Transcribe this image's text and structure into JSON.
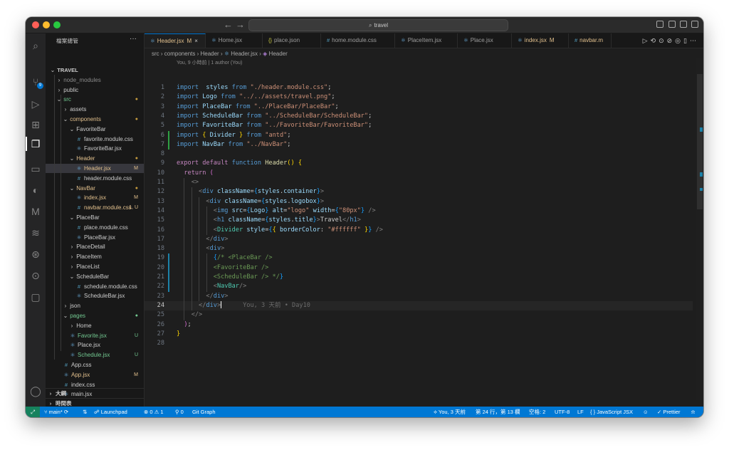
{
  "titlebar": {
    "search": "travel",
    "back": "←",
    "forward": "→"
  },
  "sidebar": {
    "title": "檔案總管",
    "more": "···",
    "tree": [
      {
        "label": "TRAVEL",
        "depth": 0,
        "type": "root",
        "chevron": "v",
        "bold": true
      },
      {
        "label": "node_modules",
        "depth": 1,
        "type": "folder",
        "chevron": ">",
        "color": "#8b8b8b"
      },
      {
        "label": "public",
        "depth": 1,
        "type": "folder",
        "chevron": ">"
      },
      {
        "label": "src",
        "depth": 1,
        "type": "folder",
        "chevron": "v",
        "color": "#73c991",
        "badge": "●",
        "badge_color": "#c49a3e"
      },
      {
        "label": "assets",
        "depth": 2,
        "type": "folder",
        "chevron": ">"
      },
      {
        "label": "components",
        "depth": 2,
        "type": "folder",
        "chevron": "v",
        "color": "#e2c08d",
        "badge": "●",
        "badge_color": "#c49a3e"
      },
      {
        "label": "FavoriteBar",
        "depth": 3,
        "type": "folder",
        "chevron": "v"
      },
      {
        "label": "favorite.module.css",
        "depth": 4,
        "type": "css"
      },
      {
        "label": "FavoriteBar.jsx",
        "depth": 4,
        "type": "react"
      },
      {
        "label": "Header",
        "depth": 3,
        "type": "folder",
        "chevron": "v",
        "color": "#e2c08d",
        "badge": "●",
        "badge_color": "#c49a3e"
      },
      {
        "label": "Header.jsx",
        "depth": 4,
        "type": "react",
        "color": "#e2c08d",
        "badge": "M",
        "badge_color": "#e2c08d",
        "selected": true
      },
      {
        "label": "header.module.css",
        "depth": 4,
        "type": "css"
      },
      {
        "label": "NavBar",
        "depth": 3,
        "type": "folder",
        "chevron": "v",
        "color": "#e2c08d",
        "badge": "●",
        "badge_color": "#c49a3e"
      },
      {
        "label": "index.jsx",
        "depth": 4,
        "type": "react",
        "color": "#e2c08d",
        "badge": "M",
        "badge_color": "#e2c08d"
      },
      {
        "label": "navbar.module.css",
        "depth": 4,
        "type": "css",
        "color": "#e2c08d",
        "badge": "1, U",
        "badge_color": "#e2c08d"
      },
      {
        "label": "PlaceBar",
        "depth": 3,
        "type": "folder",
        "chevron": "v"
      },
      {
        "label": "place.module.css",
        "depth": 4,
        "type": "css"
      },
      {
        "label": "PlaceBar.jsx",
        "depth": 4,
        "type": "react"
      },
      {
        "label": "PlaceDetail",
        "depth": 3,
        "type": "folder",
        "chevron": ">"
      },
      {
        "label": "PlaceItem",
        "depth": 3,
        "type": "folder",
        "chevron": ">"
      },
      {
        "label": "PlaceList",
        "depth": 3,
        "type": "folder",
        "chevron": ">"
      },
      {
        "label": "ScheduleBar",
        "depth": 3,
        "type": "folder",
        "chevron": "v"
      },
      {
        "label": "schedule.module.css",
        "depth": 4,
        "type": "css"
      },
      {
        "label": "ScheduleBar.jsx",
        "depth": 4,
        "type": "react"
      },
      {
        "label": "json",
        "depth": 2,
        "type": "folder",
        "chevron": ">"
      },
      {
        "label": "pages",
        "depth": 2,
        "type": "folder",
        "chevron": "v",
        "color": "#73c991",
        "badge": "●",
        "badge_color": "#73c991"
      },
      {
        "label": "Home",
        "depth": 3,
        "type": "folder",
        "chevron": ">"
      },
      {
        "label": "Favorite.jsx",
        "depth": 3,
        "type": "react",
        "color": "#73c991",
        "badge": "U",
        "badge_color": "#73c991"
      },
      {
        "label": "Place.jsx",
        "depth": 3,
        "type": "react"
      },
      {
        "label": "Schedule.jsx",
        "depth": 3,
        "type": "react",
        "color": "#73c991",
        "badge": "U",
        "badge_color": "#73c991"
      },
      {
        "label": "App.css",
        "depth": 2,
        "type": "css"
      },
      {
        "label": "App.jsx",
        "depth": 2,
        "type": "react",
        "color": "#e2c08d",
        "badge": "M",
        "badge_color": "#e2c08d"
      },
      {
        "label": "index.css",
        "depth": 2,
        "type": "css"
      },
      {
        "label": "main.jsx",
        "depth": 2,
        "type": "react"
      }
    ],
    "sections": [
      "大綱",
      "時間表"
    ]
  },
  "tabs": [
    {
      "label": "Header.jsx",
      "icon": "react",
      "active": true,
      "mod": "M",
      "color": "#e2c08d"
    },
    {
      "label": "Home.jsx",
      "icon": "react"
    },
    {
      "label": "place.json",
      "icon": "json"
    },
    {
      "label": "home.module.css",
      "icon": "css"
    },
    {
      "label": "PlaceItem.jsx",
      "icon": "react"
    },
    {
      "label": "Place.jsx",
      "icon": "react"
    },
    {
      "label": "index.jsx",
      "icon": "react",
      "mod": "M",
      "color": "#e2c08d"
    },
    {
      "label": "navbar.m",
      "icon": "css",
      "color": "#e2c08d"
    }
  ],
  "breadcrumb": [
    "src",
    "components",
    "Header",
    "Header.jsx",
    "Header"
  ],
  "blame_header": "You, 9 小時前 | 1 author (You)",
  "current_line_blame": "You, 3 天前 • Day10",
  "code_lines": [
    [
      [
        "kw",
        "import"
      ],
      [
        "",
        "  "
      ],
      [
        "var",
        "styles"
      ],
      [
        "",
        " "
      ],
      [
        "kw",
        "from"
      ],
      [
        "",
        " "
      ],
      [
        "str",
        "\"./header.module.css\""
      ],
      [
        "",
        ";"
      ]
    ],
    [
      [
        "kw",
        "import"
      ],
      [
        "",
        " "
      ],
      [
        "var",
        "Logo"
      ],
      [
        "",
        " "
      ],
      [
        "kw",
        "from"
      ],
      [
        "",
        " "
      ],
      [
        "str",
        "\"../../assets/travel.png\""
      ],
      [
        "",
        ";"
      ]
    ],
    [
      [
        "kw",
        "import"
      ],
      [
        "",
        " "
      ],
      [
        "var",
        "PlaceBar"
      ],
      [
        "",
        " "
      ],
      [
        "kw",
        "from"
      ],
      [
        "",
        " "
      ],
      [
        "str",
        "\"../PlaceBar/PlaceBar\""
      ],
      [
        "",
        ";"
      ]
    ],
    [
      [
        "kw",
        "import"
      ],
      [
        "",
        " "
      ],
      [
        "var",
        "ScheduleBar"
      ],
      [
        "",
        " "
      ],
      [
        "kw",
        "from"
      ],
      [
        "",
        " "
      ],
      [
        "str",
        "\"../ScheduleBar/ScheduleBar\""
      ],
      [
        "",
        ";"
      ]
    ],
    [
      [
        "kw",
        "import"
      ],
      [
        "",
        " "
      ],
      [
        "var",
        "FavoriteBar"
      ],
      [
        "",
        " "
      ],
      [
        "kw",
        "from"
      ],
      [
        "",
        " "
      ],
      [
        "str",
        "\"../FavoriteBar/FavoriteBar\""
      ],
      [
        "",
        ";"
      ]
    ],
    [
      [
        "kw",
        "import"
      ],
      [
        "",
        " "
      ],
      [
        "br",
        "{"
      ],
      [
        "",
        " "
      ],
      [
        "var",
        "Divider"
      ],
      [
        "",
        " "
      ],
      [
        "br",
        "}"
      ],
      [
        "",
        " "
      ],
      [
        "kw",
        "from"
      ],
      [
        "",
        " "
      ],
      [
        "str",
        "\"antd\""
      ],
      [
        "",
        ";"
      ]
    ],
    [
      [
        "kw",
        "import"
      ],
      [
        "",
        " "
      ],
      [
        "var",
        "NavBar"
      ],
      [
        "",
        " "
      ],
      [
        "kw",
        "from"
      ],
      [
        "",
        " "
      ],
      [
        "str",
        "\"../NavBar\""
      ],
      [
        "",
        ";"
      ]
    ],
    [],
    [
      [
        "kw2",
        "export"
      ],
      [
        "",
        " "
      ],
      [
        "kw2",
        "default"
      ],
      [
        "",
        " "
      ],
      [
        "kw",
        "function"
      ],
      [
        "",
        " "
      ],
      [
        "fn",
        "Header"
      ],
      [
        "br",
        "()"
      ],
      [
        "",
        " "
      ],
      [
        "br",
        "{"
      ]
    ],
    [
      [
        "",
        ""
      ],
      [
        "kw2",
        "return"
      ],
      [
        "",
        " "
      ],
      [
        "br2",
        "("
      ]
    ],
    [
      [
        "",
        "    "
      ],
      [
        "punc",
        "<>"
      ]
    ],
    [
      [
        "",
        "      "
      ],
      [
        "punc",
        "<"
      ],
      [
        "tag",
        "div"
      ],
      [
        "",
        " "
      ],
      [
        "attr",
        "className"
      ],
      [
        "",
        "="
      ],
      [
        "br3",
        "{"
      ],
      [
        "var",
        "styles"
      ],
      [
        "",
        ".",
        ""
      ],
      [
        "var",
        "container"
      ],
      [
        "br3",
        "}"
      ],
      [
        "punc",
        ">"
      ]
    ],
    [
      [
        "",
        "        "
      ],
      [
        "punc",
        "<"
      ],
      [
        "tag",
        "div"
      ],
      [
        "",
        " "
      ],
      [
        "attr",
        "className"
      ],
      [
        "",
        "="
      ],
      [
        "br3",
        "{"
      ],
      [
        "var",
        "styles"
      ],
      [
        "",
        "."
      ],
      [
        "var",
        "logobox"
      ],
      [
        "br3",
        "}"
      ],
      [
        "punc",
        ">"
      ]
    ],
    [
      [
        "",
        "          "
      ],
      [
        "punc",
        "<"
      ],
      [
        "tag",
        "img"
      ],
      [
        "",
        " "
      ],
      [
        "attr",
        "src"
      ],
      [
        "",
        "="
      ],
      [
        "br3",
        "{"
      ],
      [
        "var",
        "Logo"
      ],
      [
        "br3",
        "}"
      ],
      [
        "",
        " "
      ],
      [
        "attr",
        "alt"
      ],
      [
        "",
        "="
      ],
      [
        "str",
        "\"logo\""
      ],
      [
        "",
        " "
      ],
      [
        "attr",
        "width"
      ],
      [
        "",
        "="
      ],
      [
        "br3",
        "{"
      ],
      [
        "str",
        "\"80px\""
      ],
      [
        "br3",
        "}"
      ],
      [
        "",
        " "
      ],
      [
        "punc",
        "/>"
      ]
    ],
    [
      [
        "",
        "          "
      ],
      [
        "punc",
        "<"
      ],
      [
        "tag",
        "h1"
      ],
      [
        "",
        " "
      ],
      [
        "attr",
        "className"
      ],
      [
        "",
        "="
      ],
      [
        "br3",
        "{"
      ],
      [
        "var",
        "styles"
      ],
      [
        "",
        "."
      ],
      [
        "var",
        "title"
      ],
      [
        "br3",
        "}"
      ],
      [
        "punc",
        ">"
      ],
      [
        "",
        "Travel"
      ],
      [
        "punc",
        "</"
      ],
      [
        "tag",
        "h1"
      ],
      [
        "punc",
        ">"
      ]
    ],
    [
      [
        "",
        "          "
      ],
      [
        "punc",
        "<"
      ],
      [
        "comp",
        "Divider"
      ],
      [
        "",
        " "
      ],
      [
        "attr",
        "style"
      ],
      [
        "",
        "="
      ],
      [
        "br3",
        "{"
      ],
      [
        "br",
        "{"
      ],
      [
        "",
        " "
      ],
      [
        "var",
        "borderColor"
      ],
      [
        "",
        ": "
      ],
      [
        "str",
        "\"#ffffff\""
      ],
      [
        "",
        " "
      ],
      [
        "br",
        "}"
      ],
      [
        "br3",
        "}"
      ],
      [
        "",
        " "
      ],
      [
        "punc",
        "/>"
      ]
    ],
    [
      [
        "",
        "        "
      ],
      [
        "punc",
        "</"
      ],
      [
        "tag",
        "div"
      ],
      [
        "punc",
        ">"
      ]
    ],
    [
      [
        "",
        "        "
      ],
      [
        "punc",
        "<"
      ],
      [
        "tag",
        "div"
      ],
      [
        "punc",
        ">"
      ]
    ],
    [
      [
        "",
        "          "
      ],
      [
        "br3",
        "{"
      ],
      [
        "cmt",
        "/* <PlaceBar />"
      ]
    ],
    [
      [
        "",
        "          "
      ],
      [
        "cmt",
        "<FavoriteBar />"
      ]
    ],
    [
      [
        "",
        "          "
      ],
      [
        "cmt",
        "<ScheduleBar /> */"
      ],
      [
        "br3",
        "}"
      ]
    ],
    [
      [
        "",
        "          "
      ],
      [
        "punc",
        "<"
      ],
      [
        "comp",
        "NavBar"
      ],
      [
        "punc",
        "/>"
      ]
    ],
    [
      [
        "",
        "        "
      ],
      [
        "punc",
        "</"
      ],
      [
        "tag",
        "div"
      ],
      [
        "punc",
        ">"
      ]
    ],
    [
      [
        "",
        "      "
      ],
      [
        "punc",
        "</"
      ],
      [
        "tag",
        "div"
      ],
      [
        "punc",
        ">"
      ]
    ],
    [
      [
        "",
        "    "
      ],
      [
        "punc",
        "</>"
      ]
    ],
    [
      [
        "",
        "  "
      ],
      [
        "br2",
        ")"
      ],
      [
        "",
        ";"
      ]
    ],
    [
      [
        "br",
        "}"
      ]
    ],
    []
  ],
  "statusbar": {
    "branch": "main*",
    "launchpad": "Launchpad",
    "problems": "⊗ 0 ⚠ 1",
    "ports": "0",
    "git_graph": "Git Graph",
    "blame": "You, 3 天前",
    "position": "第 24 行，第 13 欄",
    "spaces": "空格: 2",
    "encoding": "UTF-8",
    "eol": "LF",
    "language": "JavaScript JSX",
    "prettier": "✓ Prettier"
  }
}
